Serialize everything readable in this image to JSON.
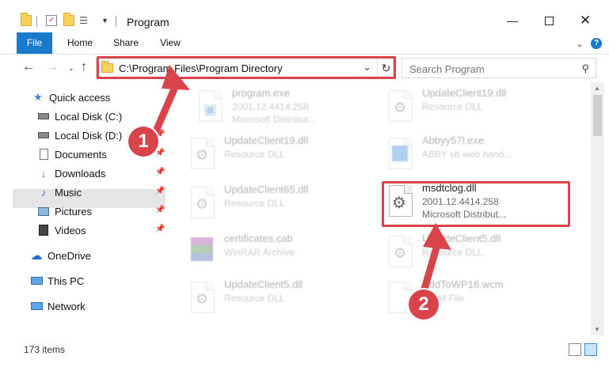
{
  "window": {
    "title": "Program",
    "controls": [
      "minimize-icon",
      "maximize-icon",
      "close-icon"
    ]
  },
  "ribbon": {
    "tabs": [
      "File",
      "Home",
      "Share",
      "View"
    ]
  },
  "address_bar": {
    "path": "C:\\Program Files\\Program Directory",
    "search_placeholder": "Search Program"
  },
  "sidebar": {
    "items": [
      {
        "label": "Quick access",
        "icon": "star-icon"
      },
      {
        "label": "Local Disk (C:)",
        "icon": "drive-icon"
      },
      {
        "label": "Local Disk (D:)",
        "icon": "drive-icon"
      },
      {
        "label": "Documents",
        "icon": "documents-icon"
      },
      {
        "label": "Downloads",
        "icon": "download-icon"
      },
      {
        "label": "Music",
        "icon": "music-icon"
      },
      {
        "label": "Pictures",
        "icon": "pictures-icon"
      },
      {
        "label": "Videos",
        "icon": "videos-icon"
      },
      {
        "label": "OneDrive",
        "icon": "cloud-icon"
      },
      {
        "label": "This PC",
        "icon": "computer-icon"
      },
      {
        "label": "Network",
        "icon": "network-icon"
      }
    ]
  },
  "files": [
    {
      "name": "program.exe",
      "line1": "2001.12.4414.258",
      "line2": "Microsoft Distribut..."
    },
    {
      "name": "UpdateClient19.dll",
      "line1": "Resource DLL",
      "line2": ""
    },
    {
      "name": "UpdateClient19.dll",
      "line1": "Resource DLL",
      "line2": ""
    },
    {
      "name": "Abbyy57l.exe",
      "line1": "ABBY sb web hand...",
      "line2": ""
    },
    {
      "name": "UpdateClient65.dll",
      "line1": "Resource DLL",
      "line2": ""
    },
    {
      "name": "msdtclog.dll",
      "line1": "2001.12.4414.258",
      "line2": "Microsoft Distribut..."
    },
    {
      "name": "certificates.cab",
      "line1": "WinRAR Archive",
      "line2": ""
    },
    {
      "name": "UpdateClient5.dll",
      "line1": "Resource DLL",
      "line2": ""
    },
    {
      "name": "UpdateClient5.dll",
      "line1": "Resource DLL",
      "line2": ""
    },
    {
      "name": "AddToWP16.wcm",
      "line1": "WCM File",
      "line2": ""
    }
  ],
  "status": {
    "item_count": "173 items"
  },
  "callouts": [
    "1",
    "2"
  ],
  "colors": {
    "accent": "#1979ca",
    "highlight": "#d9434a",
    "selected_nav": "#e5e5e5"
  }
}
